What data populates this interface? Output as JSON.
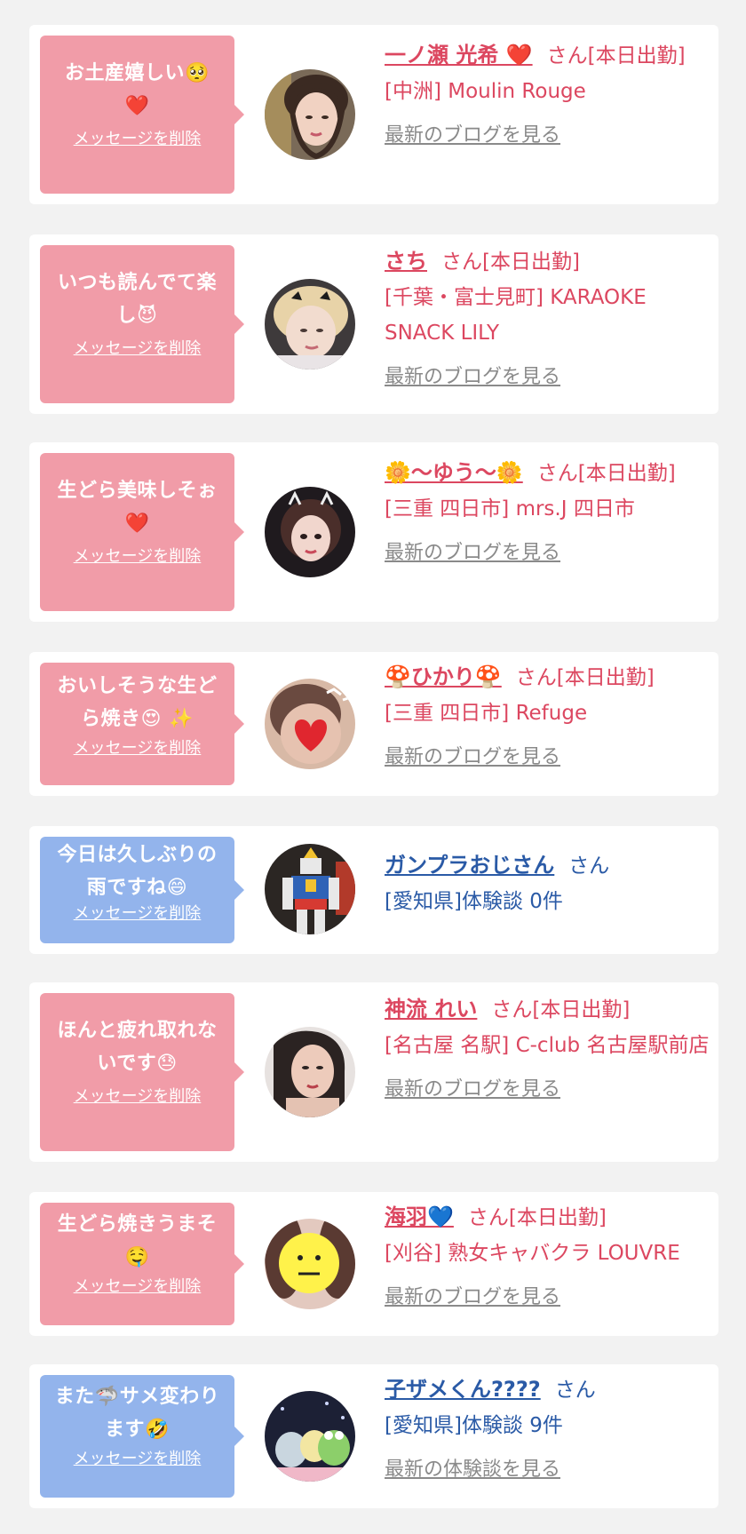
{
  "delete_label": "メッセージを削除",
  "san": "さん",
  "items": [
    {
      "message": "お土産嬉しい🥺",
      "message_emoji": "❤️",
      "name": "一ノ瀬 光希 ❤️",
      "status": "さん[本日出勤]",
      "shop": "[中洲] Moulin Rouge",
      "link": "最新のブログを見る",
      "avatar": "woman-portrait-1"
    },
    {
      "message": "いつも読んでて楽し😈",
      "message_emoji": "",
      "name": "さち",
      "status": "さん[本日出勤]",
      "shop": "[千葉・富士見町] KARAOKE SNACK LILY",
      "link": "最新のブログを見る",
      "avatar": "woman-portrait-2"
    },
    {
      "message": "生どら美味しそぉ",
      "message_emoji": "❤️",
      "name": "🌼～ゆう～🌼",
      "status": "さん[本日出勤]",
      "shop": "[三重 四日市] mrs.J 四日市",
      "link": "最新のブログを見る",
      "avatar": "woman-portrait-3"
    },
    {
      "message": "おいしそうな生どら焼き😍 ✨",
      "message_emoji": "",
      "name": "🍄ひかり🍄",
      "status": "さん[本日出勤]",
      "shop": "[三重 四日市] Refuge",
      "link": "最新のブログを見る",
      "avatar": "woman-portrait-4"
    },
    {
      "message": "今日は久しぶりの雨ですね😄",
      "message_emoji": "",
      "name": "ガンプラおじさん",
      "status": "さん",
      "shop": "[愛知県]体験談 0件",
      "link": "",
      "avatar": "robot-figure"
    },
    {
      "message": "ほんと疲れ取れないです😓",
      "message_emoji": "",
      "name": "神流 れい",
      "status": "さん[本日出勤]",
      "shop": "[名古屋 名駅] C-club 名古屋駅前店",
      "link": "最新のブログを見る",
      "avatar": "woman-portrait-5"
    },
    {
      "message": "生どら焼きうまそ",
      "message_emoji": "🤤",
      "name": "海羽💙",
      "status": "さん[本日出勤]",
      "shop": "[刈谷] 熟女キャバクラ LOUVRE",
      "link": "最新のブログを見る",
      "avatar": "woman-portrait-6"
    },
    {
      "message": "また🦈サメ変わります🤣",
      "message_emoji": "",
      "name": "子ザメくん????",
      "status": "さん",
      "shop": "[愛知県]体験談 9件",
      "link": "最新の体験談を見る",
      "avatar": "toy-figures"
    }
  ]
}
